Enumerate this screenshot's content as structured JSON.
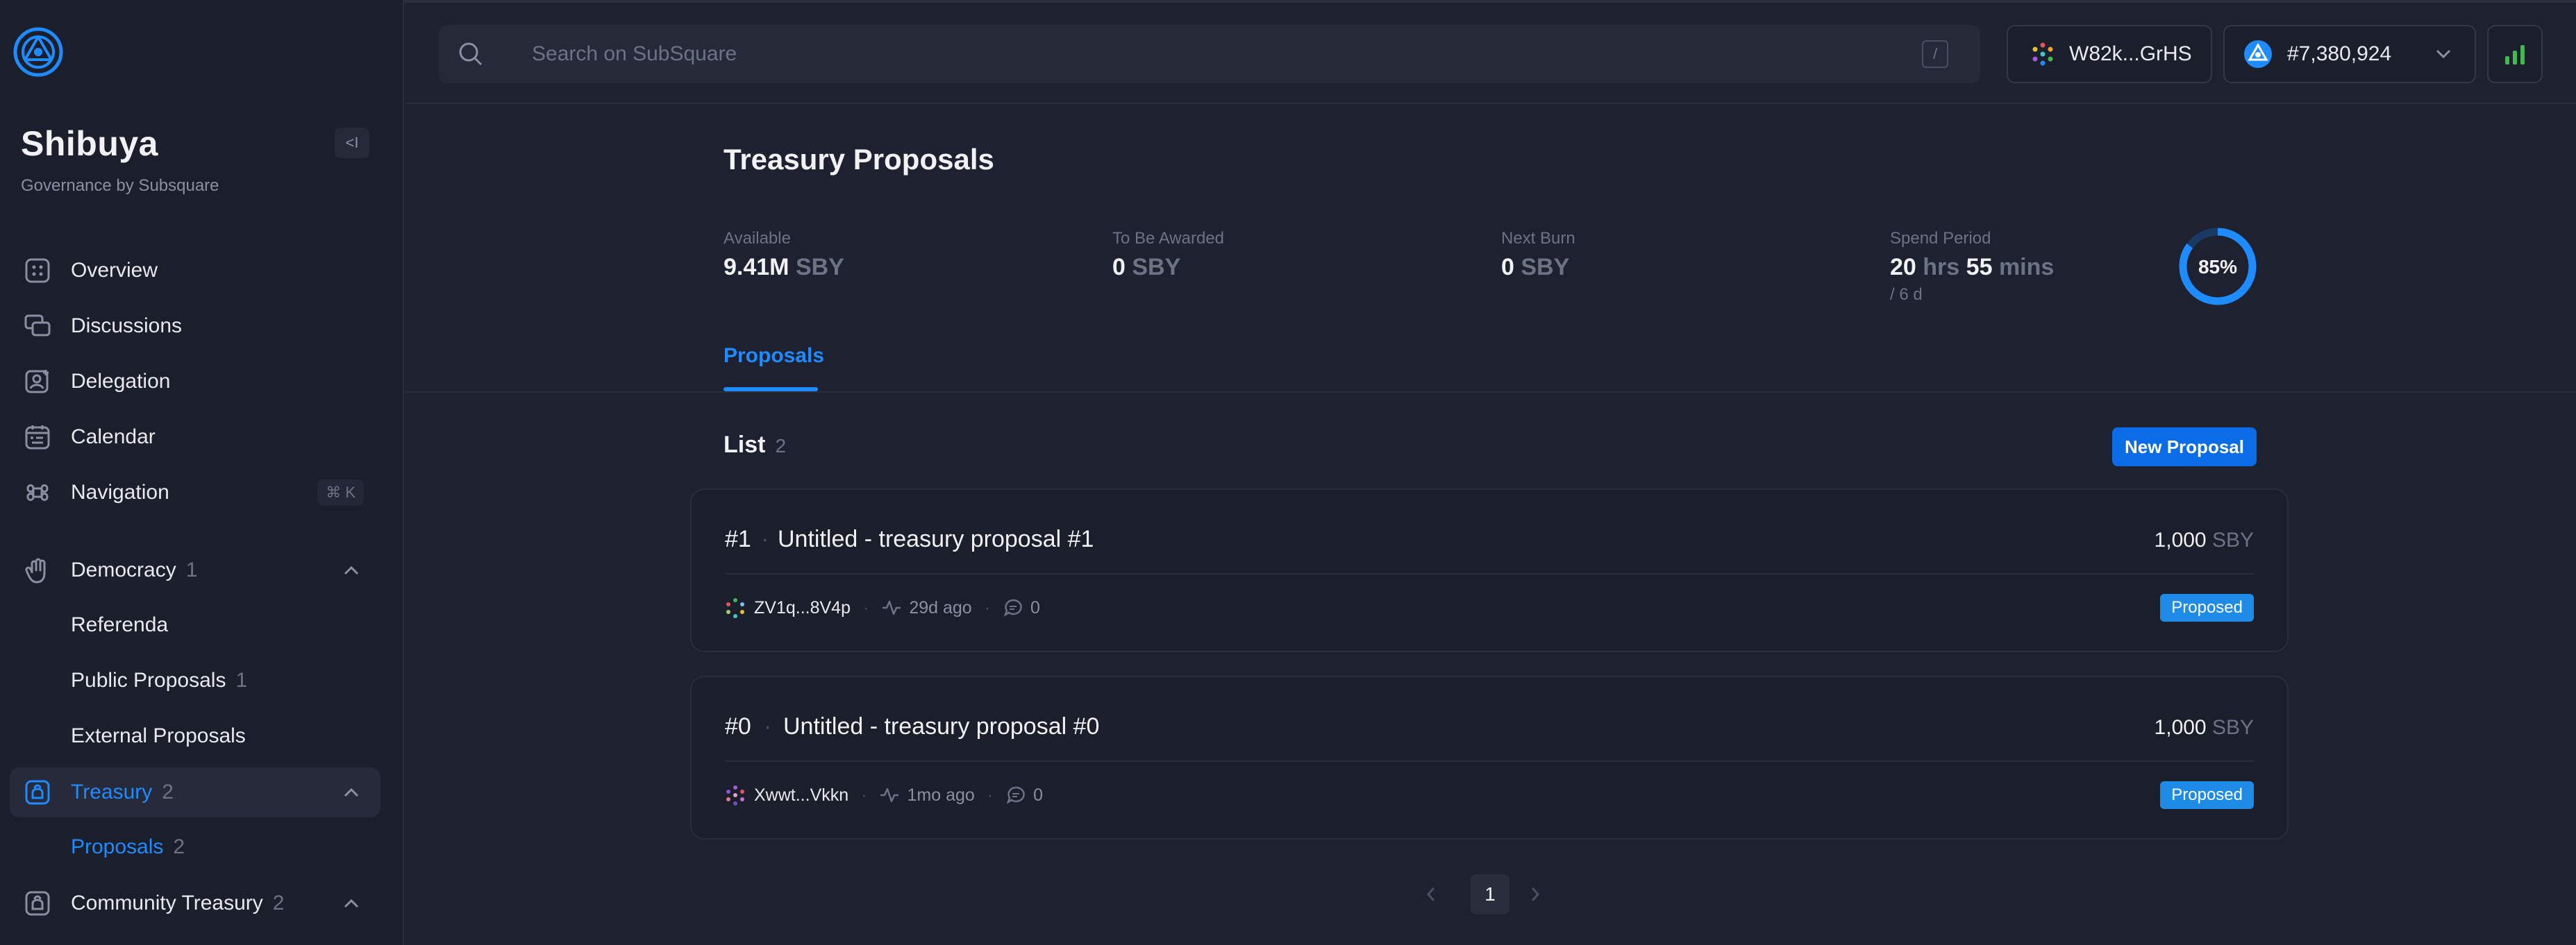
{
  "sidebar": {
    "chain_name": "Shibuya",
    "chain_sub": "Governance by Subsquare",
    "collapse_label": "<I",
    "items": [
      {
        "label": "Overview"
      },
      {
        "label": "Discussions"
      },
      {
        "label": "Delegation"
      },
      {
        "label": "Calendar"
      },
      {
        "label": "Navigation",
        "shortcut": "⌘ K"
      },
      {
        "label": "Democracy",
        "count": "1"
      },
      {
        "label": "Referenda"
      },
      {
        "label": "Public Proposals",
        "count": "1"
      },
      {
        "label": "External Proposals"
      },
      {
        "label": "Treasury",
        "count": "2"
      },
      {
        "label": "Proposals",
        "count": "2"
      },
      {
        "label": "Community Treasury",
        "count": "2"
      }
    ]
  },
  "header": {
    "search_placeholder": "Search on SubSquare",
    "search_shortcut": "/",
    "account": "W82k...GrHS",
    "block": "#7,380,924"
  },
  "main": {
    "title": "Treasury Proposals",
    "stats": [
      {
        "label": "Available",
        "value": "9.41M",
        "unit": "SBY"
      },
      {
        "label": "To Be Awarded",
        "value": "0",
        "unit": "SBY"
      },
      {
        "label": "Next Burn",
        "value": "0",
        "unit": "SBY"
      },
      {
        "label": "Spend Period",
        "v1": "20",
        "u1": "hrs",
        "v2": "55",
        "u2": "mins",
        "sub": "/ 6 d"
      }
    ],
    "progress_label": "85%",
    "progress_fraction": 0.85,
    "tab": "Proposals",
    "list_title": "List",
    "list_count": "2",
    "new_button": "New Proposal",
    "proposals": [
      {
        "index": "#1",
        "title": "Untitled - treasury proposal #1",
        "amount": "1,000",
        "unit": "SBY",
        "proposer": "ZV1q...8V4p",
        "time": "29d ago",
        "comments": "0",
        "status": "Proposed"
      },
      {
        "index": "#0",
        "title": "Untitled - treasury proposal #0",
        "amount": "1,000",
        "unit": "SBY",
        "proposer": "Xwwt...Vkkn",
        "time": "1mo ago",
        "comments": "0",
        "status": "Proposed"
      }
    ],
    "page": "1"
  },
  "colors": {
    "accent": "#1e8cff",
    "badge": "#1e8ce6",
    "button": "#0a6ce6",
    "signal": "#3fb950"
  },
  "icons": [
    "logo-icon",
    "overview-icon",
    "discussions-icon",
    "delegation-icon",
    "calendar-icon",
    "navigation-icon",
    "democracy-icon",
    "treasury-icon",
    "community-treasury-icon",
    "search-icon",
    "chevron-down-icon",
    "signal-icon",
    "time-icon",
    "comment-icon"
  ]
}
